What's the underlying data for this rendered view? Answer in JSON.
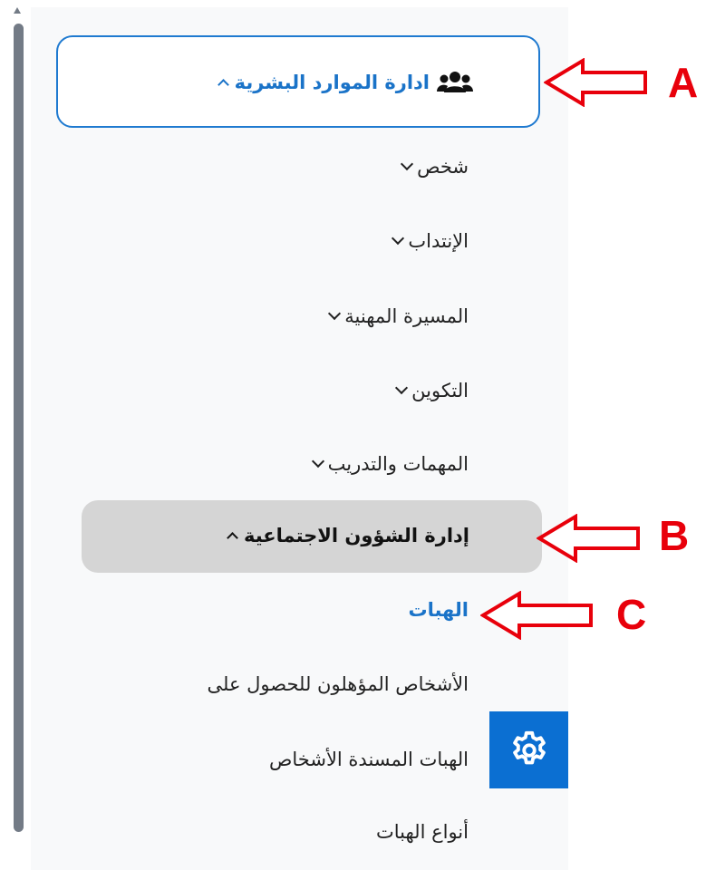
{
  "colors": {
    "accent": "#1a73c8",
    "selected_bg": "#d5d5d5",
    "annotation": "#e8000b",
    "settings_button_bg": "#0b6fd2"
  },
  "menu": {
    "hr_management": {
      "label": "ادارة الموارد البشرية",
      "icon": "users-icon",
      "expanded": true
    },
    "items": [
      {
        "label": "شخص",
        "icon": "chevron-down-icon"
      },
      {
        "label": "الإنتداب",
        "icon": "chevron-down-icon"
      },
      {
        "label": "المسيرة المهنية",
        "icon": "chevron-down-icon"
      },
      {
        "label": "التكوين",
        "icon": "chevron-down-icon"
      },
      {
        "label": "المهمات والتدريب",
        "icon": "chevron-down-icon"
      }
    ],
    "social_affairs": {
      "label": "إدارة الشؤون الاجتماعية",
      "icon": "chevron-up-icon",
      "expanded": true
    },
    "sub_items": [
      {
        "label": "الهبات",
        "active": true
      },
      {
        "label": "الأشخاص المؤهلون للحصول على",
        "active": false
      },
      {
        "label": "الهبات المسندة الأشخاص",
        "active": false
      },
      {
        "label": "أنواع الهبات",
        "active": false
      }
    ]
  },
  "settings_button": {
    "icon": "gear-icon"
  },
  "annotations": [
    {
      "letter": "A"
    },
    {
      "letter": "B"
    },
    {
      "letter": "C"
    }
  ]
}
